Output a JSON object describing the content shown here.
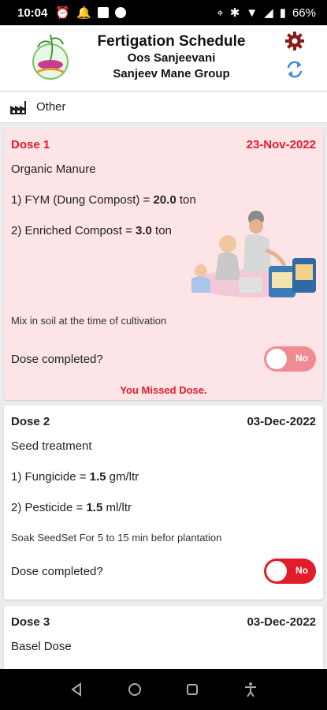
{
  "status_bar": {
    "time": "10:04",
    "battery": "66%"
  },
  "header": {
    "title": "Fertigation Schedule",
    "subtitle1": "Oos Sanjeevani",
    "subtitle2": "Sanjeev Mane Group"
  },
  "crop": {
    "label": "Other"
  },
  "colors": {
    "accent_red": "#e11d2a",
    "missed_bg": "#fde4e6",
    "settings": "#8b1a1a",
    "refresh": "#3a8fd6"
  },
  "doses": [
    {
      "title": "Dose 1",
      "date": "23-Nov-2022",
      "type": "Organic Manure",
      "items": [
        {
          "label": "1) FYM (Dung Compost) = ",
          "value": "20.0",
          "unit": " ton"
        },
        {
          "label": "2) Enriched Compost = ",
          "value": "3.0",
          "unit": " ton"
        }
      ],
      "note": "Mix in soil at the time of cultivation",
      "done_label": "Dose completed?",
      "toggle_label": "No",
      "missed": "You Missed Dose."
    },
    {
      "title": "Dose 2",
      "date": "03-Dec-2022",
      "type": "Seed treatment",
      "items": [
        {
          "label": "1) Fungicide = ",
          "value": "1.5",
          "unit": " gm/ltr"
        },
        {
          "label": "2) Pesticide = ",
          "value": "1.5",
          "unit": " ml/ltr"
        }
      ],
      "note": "Soak SeedSet For 5 to 15 min befor plantation",
      "done_label": "Dose completed?",
      "toggle_label": "No"
    },
    {
      "title": "Dose 3",
      "date": "03-Dec-2022",
      "type": "Basel Dose"
    }
  ]
}
